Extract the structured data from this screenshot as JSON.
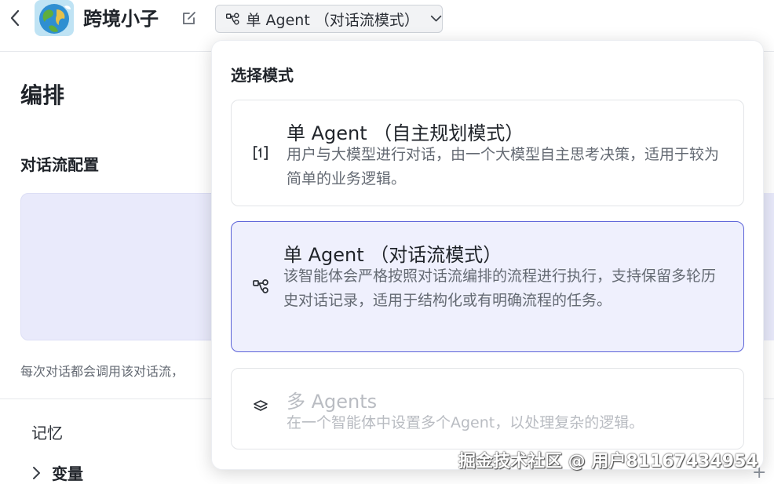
{
  "header": {
    "app_name": "跨境小子",
    "mode_label": "单 Agent （对话流模式）"
  },
  "main": {
    "section_title": "编排",
    "config_title": "对话流配置",
    "hint": "每次对话都会调用该对话流，",
    "memory_label": "记忆",
    "variables_label": "变量"
  },
  "dropdown": {
    "heading": "选择模式",
    "options": [
      {
        "title": "单 Agent （自主规划模式）",
        "description": "用户与大模型进行对话，由一个大模型自主思考决策，适用于较为简单的业务逻辑。",
        "icon": "agent-bracket-icon",
        "state": "normal"
      },
      {
        "title": "单 Agent （对话流模式）",
        "description": "该智能体会严格按照对话流编排的流程进行执行，支持保留多轮历史对话记录，适用于结构化或有明确流程的任务。",
        "icon": "flow-nodes-icon",
        "state": "selected"
      },
      {
        "title": "多 Agents",
        "description": "在一个智能体中设置多个Agent，以处理复杂的逻辑。",
        "icon": "layers-icon",
        "state": "disabled"
      }
    ]
  },
  "watermark": "掘金技术社区 @ 用户81167434954",
  "colors": {
    "accent": "#5b62d8",
    "selected_bg": "#eff0fd",
    "config_bg": "#e9eafb"
  }
}
